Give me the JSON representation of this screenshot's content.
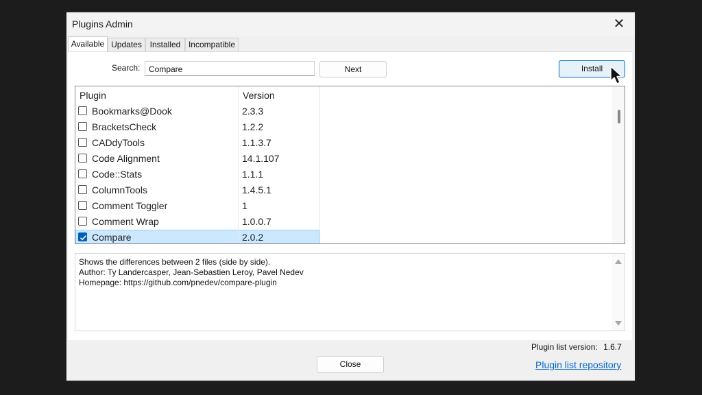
{
  "window": {
    "title": "Plugins Admin",
    "close_glyph": "✕"
  },
  "tabs": [
    {
      "label": "Available",
      "active": true
    },
    {
      "label": "Updates",
      "active": false
    },
    {
      "label": "Installed",
      "active": false
    },
    {
      "label": "Incompatible",
      "active": false
    }
  ],
  "search": {
    "label": "Search:",
    "value": "Compare"
  },
  "buttons": {
    "next": "Next",
    "install": "Install",
    "close": "Close"
  },
  "list": {
    "columns": {
      "plugin": "Plugin",
      "version": "Version"
    },
    "rows": [
      {
        "name": "Bookmarks@Dook",
        "version": "2.3.3",
        "checked": false
      },
      {
        "name": "BracketsCheck",
        "version": "1.2.2",
        "checked": false
      },
      {
        "name": "CADdyTools",
        "version": "1.1.3.7",
        "checked": false
      },
      {
        "name": "Code Alignment",
        "version": "14.1.107",
        "checked": false
      },
      {
        "name": "Code::Stats",
        "version": "1.1.1",
        "checked": false
      },
      {
        "name": "ColumnTools",
        "version": "1.4.5.1",
        "checked": false
      },
      {
        "name": "Comment Toggler",
        "version": "1",
        "checked": false
      },
      {
        "name": "Comment Wrap",
        "version": "1.0.0.7",
        "checked": false
      },
      {
        "name": "Compare",
        "version": "2.0.2",
        "checked": true,
        "selected": true
      }
    ]
  },
  "description": {
    "lines": [
      "Shows the differences between 2 files (side by side).",
      "Author: Ty Landercasper, Jean-Sebastien Leroy, Pavel Nedev",
      "Homepage: https://github.com/pnedev/compare-plugin"
    ]
  },
  "footer": {
    "list_version_label": "Plugin list version:",
    "list_version_value": "1.6.7",
    "repo_link": "Plugin list repository"
  },
  "colors": {
    "accent": "#005fb8",
    "selection": "#cce8ff",
    "link": "#0066cc"
  }
}
